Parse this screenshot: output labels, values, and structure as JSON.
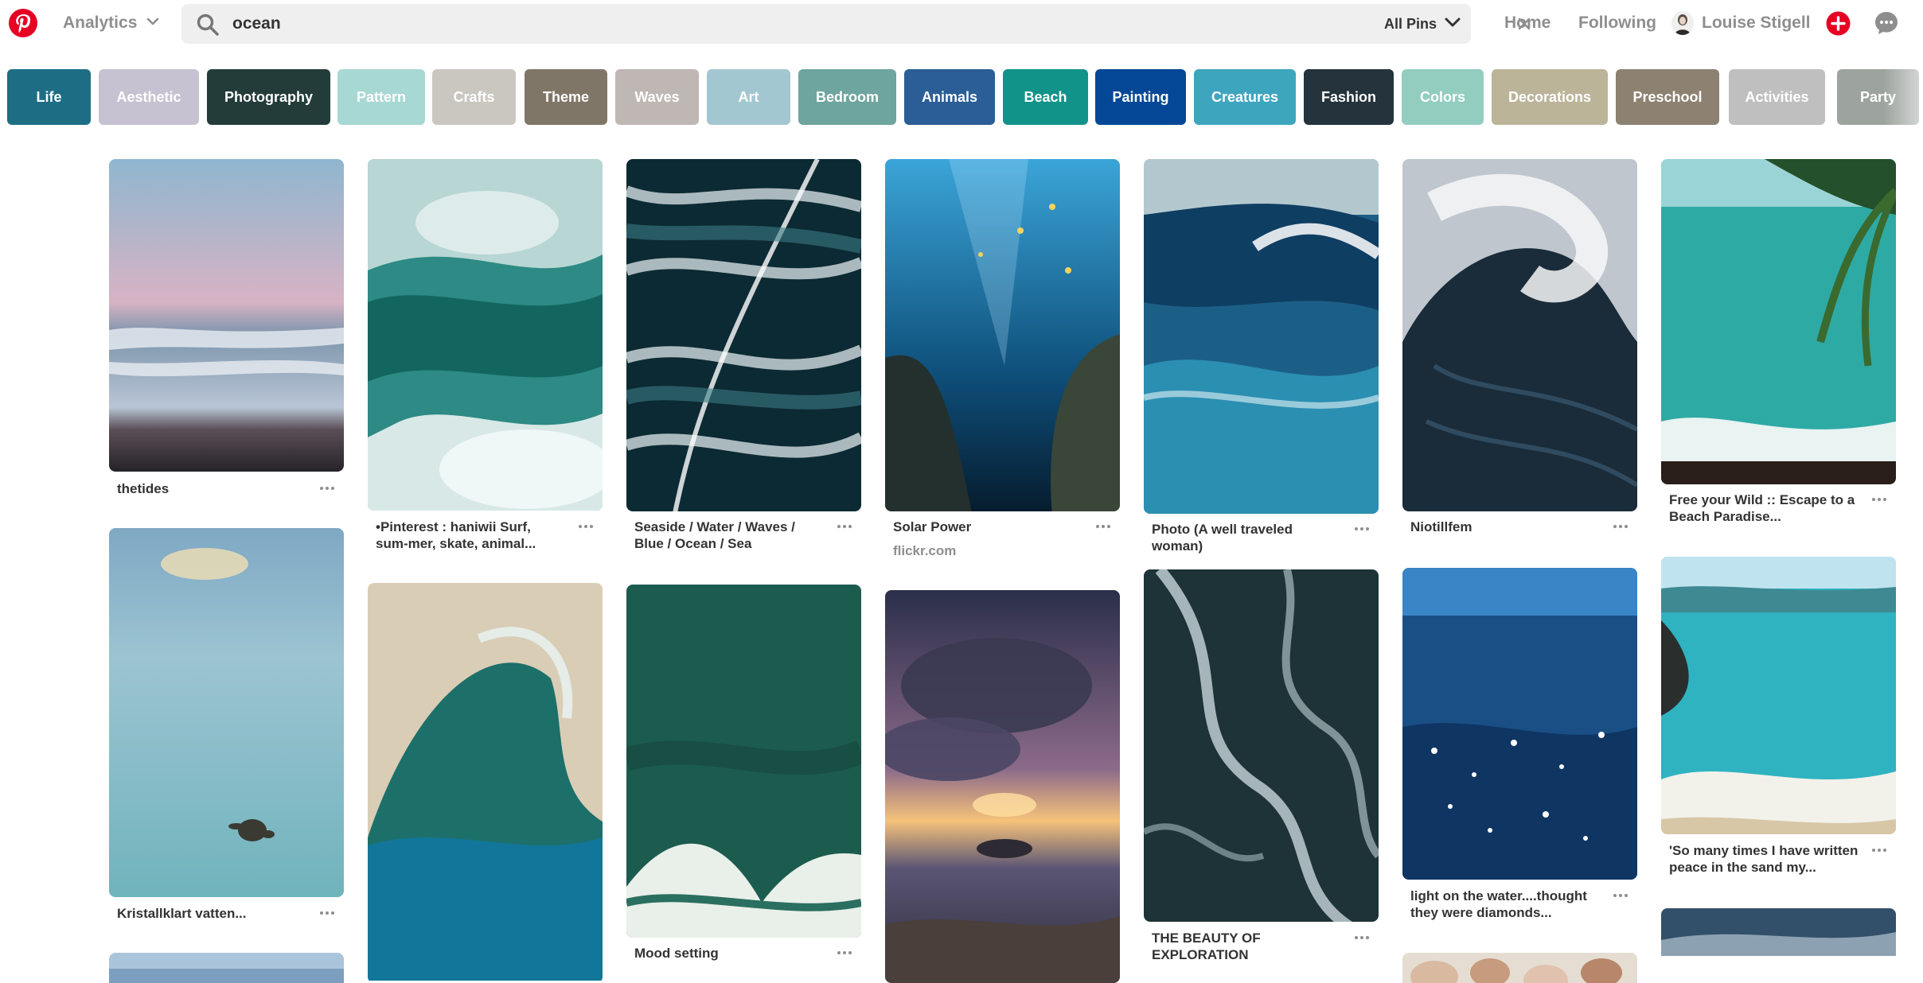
{
  "header": {
    "analytics_label": "Analytics",
    "search_value": "ocean",
    "filter_label": "All Pins",
    "nav_home": "Home",
    "nav_following": "Following",
    "user_name": "Louise Stigell",
    "brand_color": "#e60023"
  },
  "chips": [
    {
      "label": "Life",
      "color": "#1d6e84"
    },
    {
      "label": "Aesthetic",
      "color": "#c6c2d2"
    },
    {
      "label": "Photography",
      "color": "#233c3a"
    },
    {
      "label": "Pattern",
      "color": "#a8d8d4"
    },
    {
      "label": "Crafts",
      "color": "#c9c7c0"
    },
    {
      "label": "Theme",
      "color": "#807668"
    },
    {
      "label": "Waves",
      "color": "#bfb7b4"
    },
    {
      "label": "Art",
      "color": "#a3c7d1"
    },
    {
      "label": "Bedroom",
      "color": "#6ea59e"
    },
    {
      "label": "Animals",
      "color": "#2b5e96"
    },
    {
      "label": "Beach",
      "color": "#12938a"
    },
    {
      "label": "Painting",
      "color": "#044796"
    },
    {
      "label": "Creatures",
      "color": "#3ea5bf"
    },
    {
      "label": "Fashion",
      "color": "#24333c"
    },
    {
      "label": "Colors",
      "color": "#92cdc0"
    },
    {
      "label": "Decorations",
      "color": "#bcb499"
    },
    {
      "label": "Preschool",
      "color": "#8d8171"
    },
    {
      "label": "Activities",
      "color": "#bfbfbf"
    },
    {
      "label": "Party",
      "color": "#9da39f"
    }
  ],
  "pins": [
    {
      "title": "thetides",
      "source": ""
    },
    {
      "title": "Kristallklart vatten...",
      "source": ""
    },
    {
      "title": "",
      "source": ""
    },
    {
      "title": "•Pinterest : haniwii Surf, sum-mer, skate, animal...",
      "source": ""
    },
    {
      "title": "",
      "source": ""
    },
    {
      "title": "Seaside / Water / Waves / Blue / Ocean / Sea",
      "source": ""
    },
    {
      "title": "Mood setting",
      "source": ""
    },
    {
      "title": "Solar Power",
      "source": "flickr.com"
    },
    {
      "title": "",
      "source": ""
    },
    {
      "title": "Photo (A well traveled woman)",
      "source": ""
    },
    {
      "title": "THE BEAUTY OF EXPLORATION",
      "source": ""
    },
    {
      "title": "Niotillfem",
      "source": ""
    },
    {
      "title": "light on the water....thought they were diamonds...",
      "source": ""
    },
    {
      "title": "",
      "source": ""
    },
    {
      "title": "Free your Wild :: Escape to a Beach Paradise...",
      "source": ""
    },
    {
      "title": "'So many times I have written peace in the sand my...",
      "source": ""
    },
    {
      "title": "",
      "source": ""
    }
  ]
}
